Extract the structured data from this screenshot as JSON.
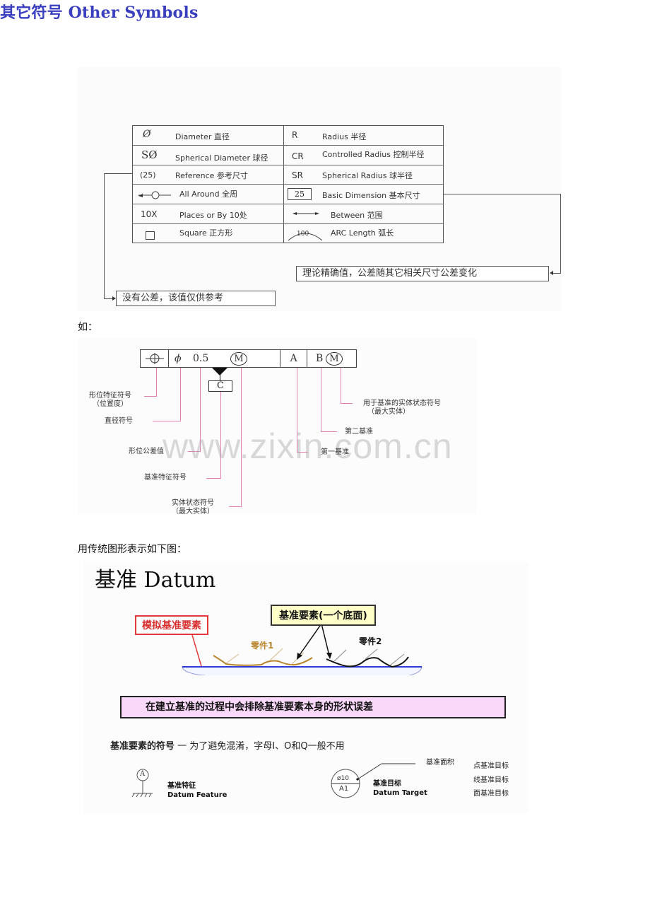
{
  "section_other_symbols": {
    "title": "其它符号 Other Symbols",
    "title_color": "#3a3fbf",
    "left_column": [
      {
        "symbol": "Ø",
        "label": "Diameter  直径"
      },
      {
        "symbol": "SØ",
        "label": "Spherical Diameter  球径"
      },
      {
        "symbol": "(25)",
        "label": "Reference  参考尺寸"
      },
      {
        "symbol": "all-around-icon",
        "label": "All Around  全周"
      },
      {
        "symbol": "10X",
        "label": "Places or By  10处"
      },
      {
        "symbol": "square-icon",
        "label": "Square 正方形"
      }
    ],
    "right_column": [
      {
        "symbol": "R",
        "label": "Radius   半径"
      },
      {
        "symbol": "CR",
        "label": "Controlled Radius 控制半径"
      },
      {
        "symbol": "SR",
        "label": "Spherical Radius 球半径"
      },
      {
        "symbol": "25",
        "label": "Basic Dimension 基本尺寸"
      },
      {
        "symbol": "between-arrow-icon",
        "label": "Between  范围"
      },
      {
        "symbol": "100",
        "label": "ARC Length  弧长"
      }
    ],
    "note_basic": "理论精确值，公差随其它相关尺寸公差变化",
    "note_reference": "没有公差，该值仅供参考"
  },
  "section_example": {
    "intro": "如：",
    "frame": {
      "symbol": "position-icon",
      "diameter": "ϕ",
      "tolerance": "0.5",
      "modifier": "M",
      "datum_primary": "A",
      "datum_secondary": "B",
      "datum_secondary_modifier": "M",
      "datum_feature": "C"
    },
    "labels": {
      "characteristic": "形位特征符号",
      "characteristic_sub": "（位置度）",
      "diameter": "直径符号",
      "tolerance": "形位公差值",
      "datum_feature": "基准特征符号",
      "material": "实体状态符号",
      "material_sub": "（最大实体）",
      "datum_material": "用于基准的实体状态符号",
      "datum_material_sub": "（最大实体）",
      "secondary": "第二基准",
      "primary": "第一基准"
    },
    "leader_color": "#e47fb4",
    "watermark": "www.zixin.com.cn"
  },
  "section_datum": {
    "intro": "用传统图形表示如下图：",
    "title": "基准 Datum",
    "callout_simulated": "模拟基准要素",
    "callout_feature": "基准要素(一个底面)",
    "part1": "零件1",
    "part2": "零件2",
    "banner": "在建立基准的过程中会排除基准要素本身的形状误差",
    "symbol_line_bold": "基准要素的符号",
    "symbol_line_rest": " 一 为了避免混淆，字母I、O和Q一般不用",
    "datum_feature_cn": "基准特征",
    "datum_feature_en": "Datum Feature",
    "datum_feature_letter": "A",
    "datum_target_cn": "基准目标",
    "datum_target_en": "Datum Target",
    "target_top": "ø10",
    "target_bottom": "A1",
    "target_area": "基准面积",
    "target_types": [
      "点基准目标",
      "线基准目标",
      "面基准目标"
    ],
    "colors": {
      "red": "#e03a3a",
      "yellow_fill": "#ffffc8",
      "banner_fill": "#fad8fa",
      "part1": "#b8862e",
      "plate": "#2a3bd6"
    }
  }
}
